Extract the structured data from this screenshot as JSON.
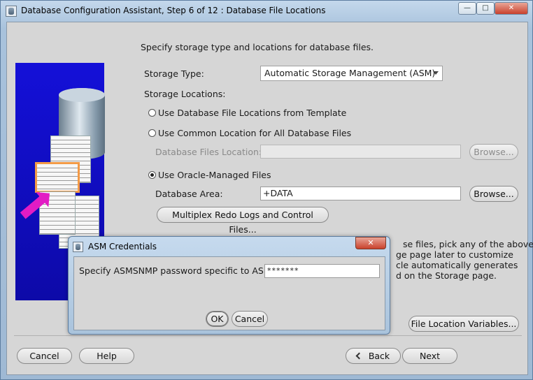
{
  "window": {
    "title": "Database Configuration Assistant, Step 6 of 12 : Database File Locations",
    "controls": {
      "minimize": "—",
      "maximize": "□",
      "close": "✕"
    }
  },
  "main": {
    "intro": "Specify storage type and locations for database files.",
    "storage_type_label": "Storage Type:",
    "storage_type_value": "Automatic Storage Management (ASM)",
    "storage_locations_label": "Storage Locations:",
    "options": {
      "template": "Use Database File Locations from Template",
      "common": "Use Common Location for All Database Files",
      "omf": "Use Oracle-Managed Files"
    },
    "db_files_location_label": "Database Files Location:",
    "db_files_location_value": "",
    "db_area_label": "Database Area:",
    "db_area_value": "+DATA",
    "browse_label": "Browse...",
    "multiplex_label": "Multiplex Redo Logs and Control Files...",
    "description_lines": [
      "se files, pick any of the above",
      "ge page later to customize",
      "cle automatically generates",
      "d on the Storage page."
    ],
    "file_location_variables_label": "File Location Variables..."
  },
  "footer": {
    "cancel": "Cancel",
    "help": "Help",
    "back": "Back",
    "next": "Next"
  },
  "dialog": {
    "title": "ASM Credentials",
    "close": "✕",
    "prompt": "Specify ASMSNMP password specific to ASM:",
    "password_value": "*******",
    "ok": "OK",
    "cancel": "Cancel"
  }
}
